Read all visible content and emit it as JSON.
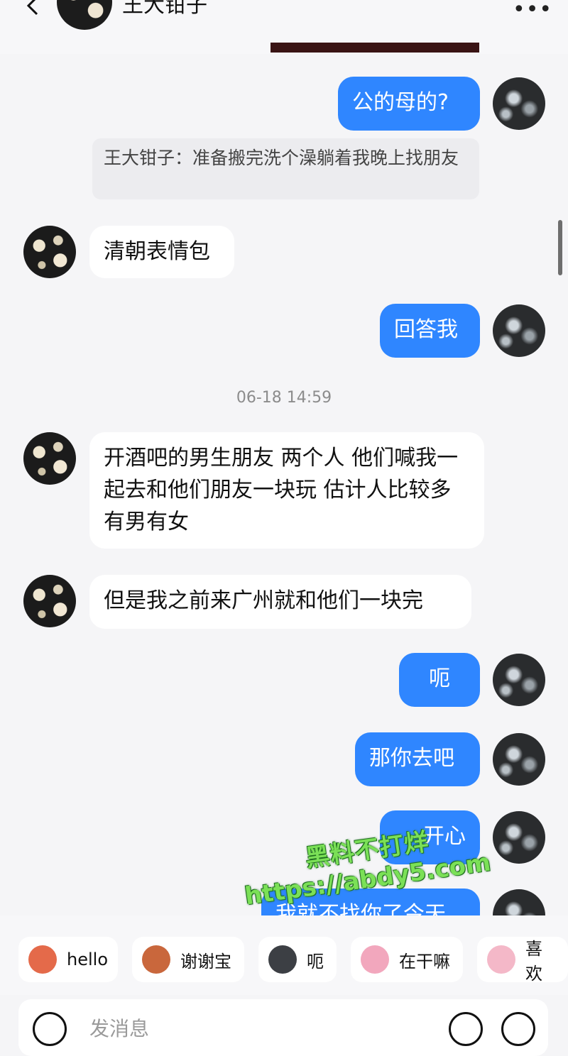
{
  "header": {
    "title": "王大钳子",
    "more": "•••"
  },
  "quote": {
    "text": "王大钳子：准备搬完洗个澡躺着我晚上找朋友"
  },
  "messages": {
    "m1": "公的母的?",
    "m2": "清朝表情包",
    "m3": "回答我",
    "m4": "开酒吧的男生朋友 两个人 他们喊我一起去和他们朋友一块玩 估计人比较多 有男有女",
    "m5": "但是我之前来广州就和他们一块完",
    "m6": "呃",
    "m7": "那你去吧",
    "m8": "开心",
    "m9": "我就不找你了今天"
  },
  "timestamp": "06-18 14:59",
  "watermark": {
    "line1": "黑料不打烊",
    "line2": "https://abdy5.com"
  },
  "quick_replies": [
    "hello",
    "谢谢宝",
    "呃",
    "在干嘛",
    "喜欢"
  ],
  "input": {
    "placeholder": "发消息"
  },
  "colors": {
    "my_bubble": "#2f86ff",
    "their_bubble": "#ffffff",
    "background": "#f5f5f7",
    "watermark": "#7be057"
  }
}
